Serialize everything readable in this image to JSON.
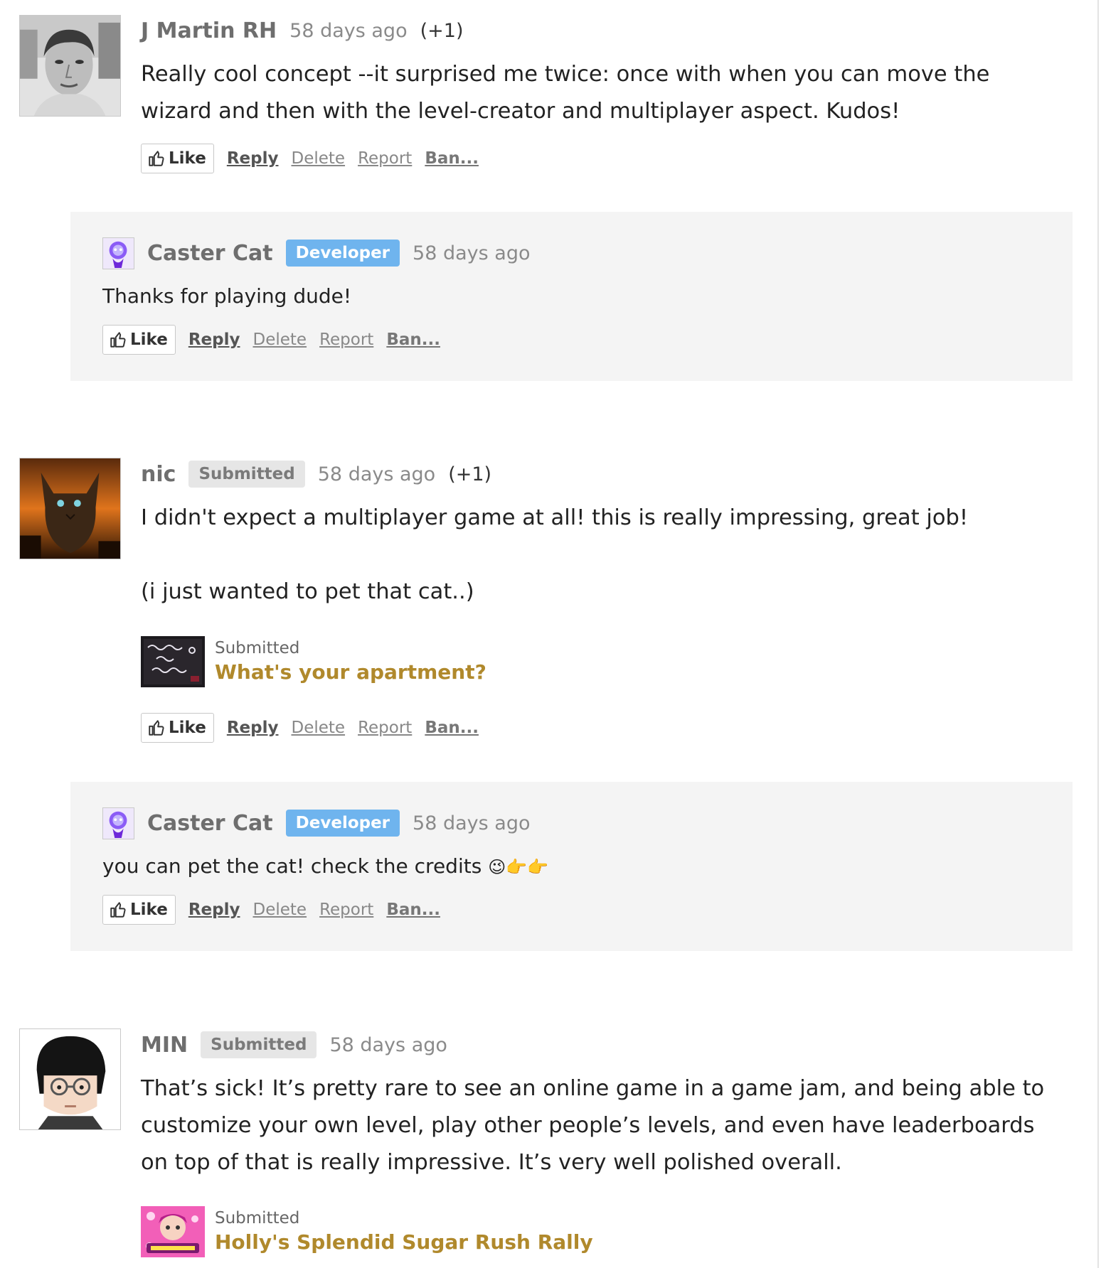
{
  "actions": {
    "like": "Like",
    "reply": "Reply",
    "delete": "Delete",
    "report": "Report",
    "ban": "Ban..."
  },
  "comments": [
    {
      "author": "J Martin RH",
      "time": "58 days ago",
      "votes": "(+1)",
      "text": "Really cool concept --it surprised me twice: once with when you can move the wizard and then with the level-creator and multiplayer aspect. Kudos!",
      "reply": {
        "author": "Caster Cat",
        "badge": "Developer",
        "time": "58 days ago",
        "text": "Thanks for playing dude!"
      }
    },
    {
      "author": "nic",
      "badge": "Submitted",
      "time": "58 days ago",
      "votes": "(+1)",
      "text": "I didn't expect a multiplayer game at all! this is really impressing, great job!",
      "text2": "(i just wanted to pet that cat..)",
      "attachment": {
        "label": "Submitted",
        "title": "What's your apartment?",
        "thumb_text": "What's your apartment?"
      },
      "reply": {
        "author": "Caster Cat",
        "badge": "Developer",
        "time": "58 days ago",
        "text": "you can pet the cat! check the credits",
        "emoji": "😉👉👉"
      }
    },
    {
      "author": "MIN",
      "badge": "Submitted",
      "time": "58 days ago",
      "text": "That’s sick! It’s pretty rare to see an online game in a game jam, and being able to customize your own level, play other people’s levels, and even have leaderboards on top of that is really impressive. It’s very well polished overall.",
      "attachment": {
        "label": "Submitted",
        "title": "Holly's Splendid Sugar Rush Rally",
        "thumb_text": "Holly's Splendid Sugar Rush Rally"
      }
    }
  ]
}
